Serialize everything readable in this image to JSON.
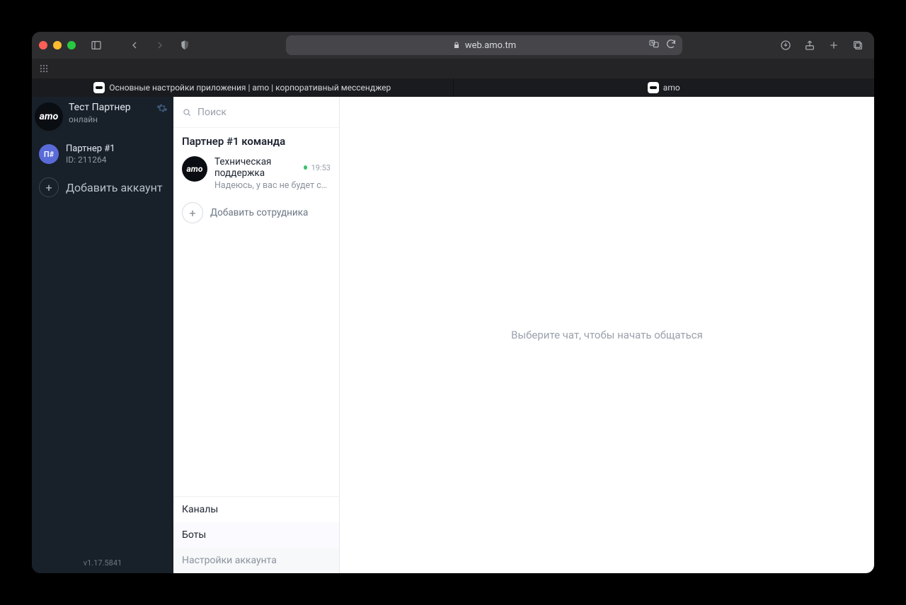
{
  "browser": {
    "url": "web.amo.tm",
    "tabs": [
      {
        "title": "Основные настройки приложения | amo | корпоративный мессенджер",
        "favicon_label": "amo"
      },
      {
        "title": "amo",
        "favicon_label": "amo"
      }
    ]
  },
  "sidebar": {
    "profile": {
      "name": "Тест Партнер",
      "status": "онлайн",
      "avatar_text": "amo"
    },
    "account": {
      "name": "Партнер #1",
      "id_label": "ID: 211264",
      "badge": "П#"
    },
    "add_account_label": "Добавить аккаунт",
    "version": "v1.17.5841"
  },
  "chatlist": {
    "search_placeholder": "Поиск",
    "team_title": "Партнер #1 команда",
    "items": [
      {
        "name": "Техническая поддержка",
        "time": "19:53",
        "preview": "Надеюсь, у вас не будет слож…",
        "avatar_text": "amo",
        "online": true
      }
    ],
    "add_employee_label": "Добавить сотрудника",
    "footer": {
      "channels": "Каналы",
      "bots": "Боты",
      "settings": "Настройки аккаунта"
    }
  },
  "main": {
    "placeholder": "Выберите чат, чтобы начать общаться"
  }
}
